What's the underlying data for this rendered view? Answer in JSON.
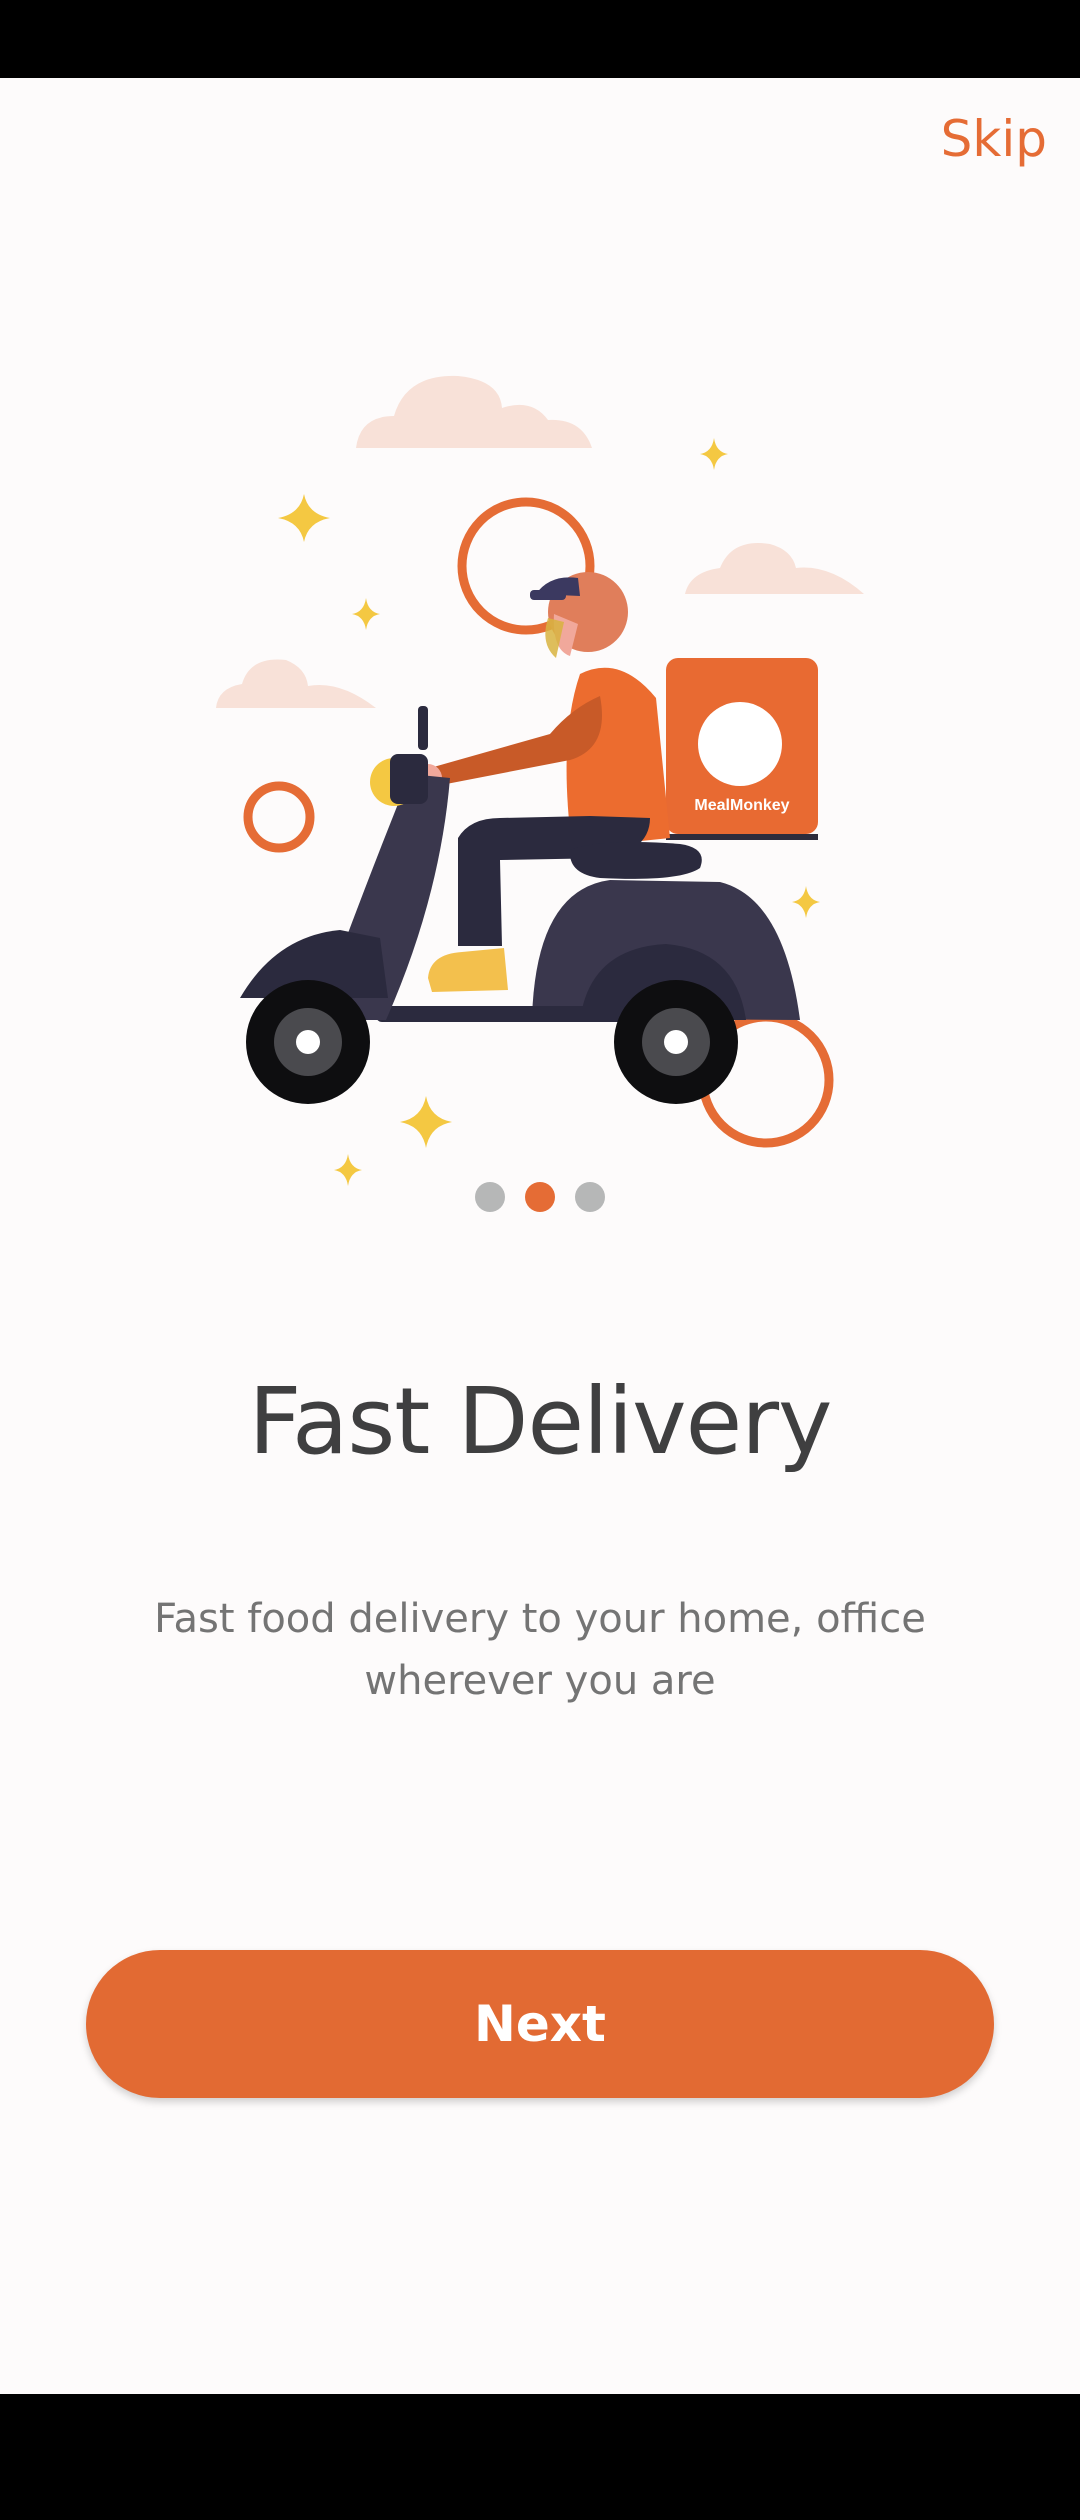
{
  "header": {
    "skip_label": "Skip"
  },
  "illustration": {
    "brand_label": "MealMonkey"
  },
  "pager": {
    "count": 3,
    "active_index": 1
  },
  "content": {
    "title": "Fast Delivery",
    "subtitle_line1": "Fast food delivery to your home, office",
    "subtitle_line2": "wherever you are"
  },
  "actions": {
    "next_label": "Next"
  },
  "colors": {
    "accent": "#e56c35",
    "background": "#fdfbfb",
    "title_text": "#3f3f40",
    "subtitle_text": "#747474",
    "dot_inactive": "#b6b7b7"
  }
}
